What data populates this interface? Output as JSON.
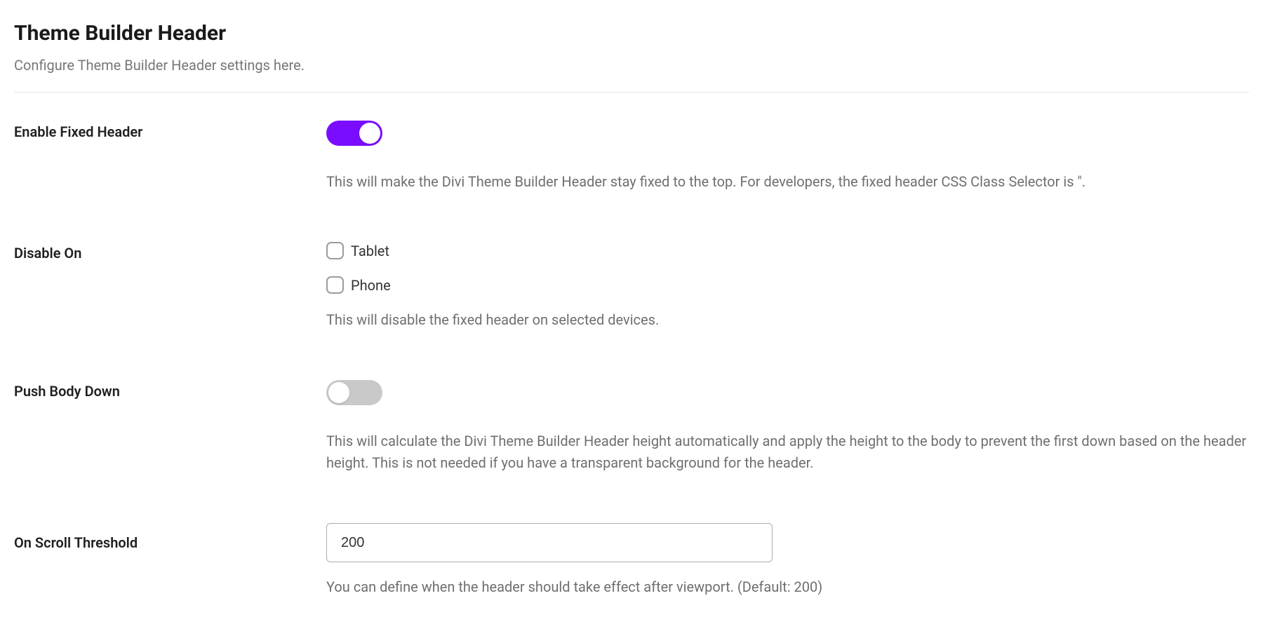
{
  "header": {
    "title": "Theme Builder Header",
    "subtitle": "Configure Theme Builder Header settings here."
  },
  "settings": {
    "enable_fixed": {
      "label": "Enable Fixed Header",
      "on": true,
      "help": "This will make the Divi Theme Builder Header stay fixed to the top. For developers, the fixed header CSS Class Selector is \"."
    },
    "disable_on": {
      "label": "Disable On",
      "options": [
        {
          "label": "Tablet",
          "checked": false
        },
        {
          "label": "Phone",
          "checked": false
        }
      ],
      "help": "This will disable the fixed header on selected devices."
    },
    "push_body": {
      "label": "Push Body Down",
      "on": false,
      "help": "This will calculate the Divi Theme Builder Header height automatically and apply the height to the body to prevent the first down based on the header height. This is not needed if you have a transparent background for the header."
    },
    "threshold": {
      "label": "On Scroll Threshold",
      "value": "200",
      "help": "You can define when the header should take effect after viewport. (Default: 200)"
    }
  }
}
